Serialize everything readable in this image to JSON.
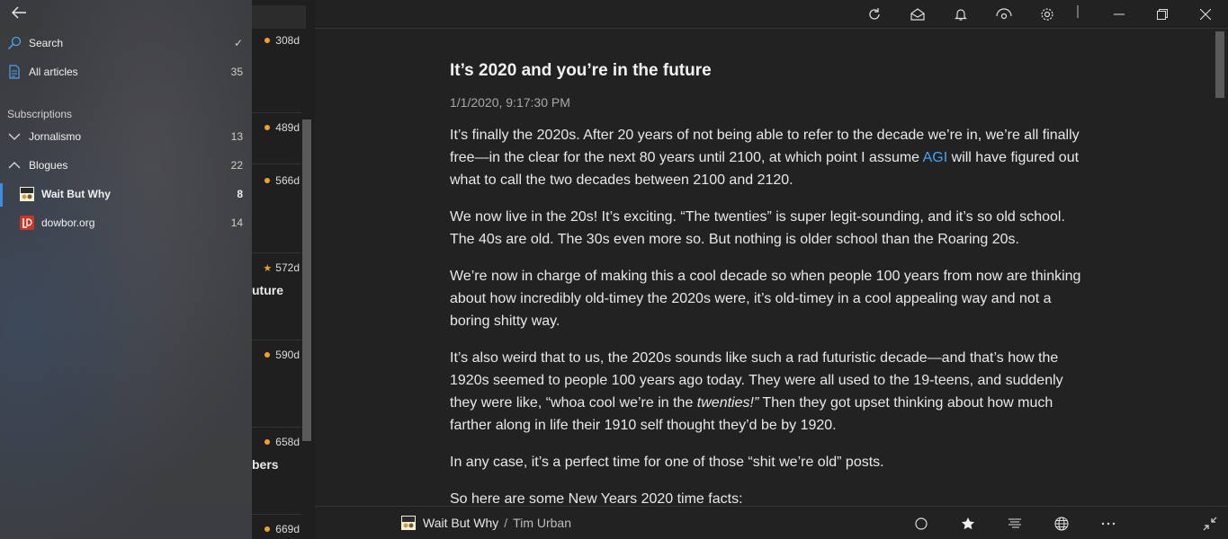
{
  "drawer": {
    "search_label": "Search",
    "search_check": "✓",
    "all_articles_label": "All articles",
    "all_articles_count": "35",
    "subscriptions_label": "Subscriptions",
    "groups": [
      {
        "label": "Jornalismo",
        "count": "13",
        "expanded": false
      },
      {
        "label": "Blogues",
        "count": "22",
        "expanded": true
      }
    ],
    "feeds": [
      {
        "label": "Wait But Why",
        "count": "8",
        "selected": true
      },
      {
        "label": "dowbor.org",
        "count": "14",
        "selected": false
      }
    ]
  },
  "list": {
    "items": [
      {
        "age": "308d",
        "marker": "dot",
        "title_fragment": ""
      },
      {
        "age": "489d",
        "marker": "dot",
        "title_fragment": ""
      },
      {
        "age": "566d",
        "marker": "dot",
        "title_fragment": ""
      },
      {
        "age": "572d",
        "marker": "star",
        "title_fragment": "uture"
      },
      {
        "age": "590d",
        "marker": "dot",
        "title_fragment": ""
      },
      {
        "age": "658d",
        "marker": "dot",
        "title_fragment": "bers"
      },
      {
        "age": "669d",
        "marker": "dot",
        "title_fragment": ""
      }
    ]
  },
  "article": {
    "title": "It’s 2020 and you’re in the future",
    "date": "1/1/2020, 9:17:30 PM",
    "p1_a": "It’s finally the 2020s. After 20 years of not being able to refer to the decade we’re in, we’re all finally free—in the clear for the next 80 years until 2100, at which point I assume ",
    "p1_link": "AGI",
    "p1_b": " will have figured out what to call the two decades between 2100 and 2120.",
    "p2": "We now live in the 20s! It’s exciting. “The twenties” is super legit-sounding, and it’s so old school. The 40s are old. The 30s even more so. But nothing is older school than the Roaring 20s.",
    "p3": "We’re now in charge of making this a cool decade so when people 100 years from now are thinking about how incredibly old-timey the 2020s were, it’s old-timey in a cool appealing way and not a boring shitty way.",
    "p4_a": "It’s also weird that to us, the 2020s sounds like such a rad futuristic decade—and that’s how the 1920s seemed to people 100 years ago today. They were all used to the 19-teens, and suddenly they were like, “whoa cool we’re in the ",
    "p4_em": "twenties!”",
    "p4_b": " Then they got upset thinking about how much farther along in life their 1910 self thought they’d be by 1920.",
    "p5": "In any case, it’s a perfect time for one of those “shit we’re old” posts.",
    "p6": "So here are some New Years 2020 time facts:"
  },
  "footer": {
    "feed": "Wait But Why",
    "separator": "/",
    "author": "Tim Urban"
  },
  "colors": {
    "accent": "#3a8ee6",
    "unread_dot": "#f0a030",
    "link": "#4aa3f0"
  }
}
